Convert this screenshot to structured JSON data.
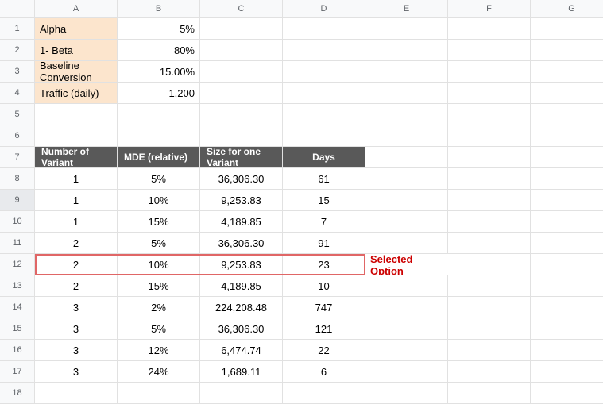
{
  "columns": [
    "A",
    "B",
    "C",
    "D",
    "E",
    "F",
    "G"
  ],
  "rows": [
    "1",
    "2",
    "3",
    "4",
    "5",
    "6",
    "7",
    "8",
    "9",
    "10",
    "11",
    "12",
    "13",
    "14",
    "15",
    "16",
    "17",
    "18"
  ],
  "params": {
    "alpha_label": "Alpha",
    "alpha_value": "5%",
    "beta_label": "1- Beta",
    "beta_value": "80%",
    "baseline_label": "Baseline Conversion",
    "baseline_value": "15.00%",
    "traffic_label": "Traffic (daily)",
    "traffic_value": "1,200"
  },
  "table_headers": {
    "variant": "Number of Variant",
    "mde": "MDE (relative)",
    "size": "Size for one Variant",
    "days": "Days"
  },
  "table_rows": [
    {
      "variant": "1",
      "mde": "5%",
      "size": "36,306.30",
      "days": "61"
    },
    {
      "variant": "1",
      "mde": "10%",
      "size": "9,253.83",
      "days": "15"
    },
    {
      "variant": "1",
      "mde": "15%",
      "size": "4,189.85",
      "days": "7"
    },
    {
      "variant": "2",
      "mde": "5%",
      "size": "36,306.30",
      "days": "91"
    },
    {
      "variant": "2",
      "mde": "10%",
      "size": "9,253.83",
      "days": "23"
    },
    {
      "variant": "2",
      "mde": "15%",
      "size": "4,189.85",
      "days": "10"
    },
    {
      "variant": "3",
      "mde": "2%",
      "size": "224,208.48",
      "days": "747"
    },
    {
      "variant": "3",
      "mde": "5%",
      "size": "36,306.30",
      "days": "121"
    },
    {
      "variant": "3",
      "mde": "12%",
      "size": "6,474.74",
      "days": "22"
    },
    {
      "variant": "3",
      "mde": "24%",
      "size": "1,689.11",
      "days": "6"
    }
  ],
  "annotation": "Selected Option",
  "selected_row_index": 4,
  "chart_data": {
    "type": "table",
    "parameters": {
      "Alpha": 0.05,
      "1- Beta": 0.8,
      "Baseline Conversion": 0.15,
      "Traffic (daily)": 1200
    },
    "columns": [
      "Number of Variant",
      "MDE (relative)",
      "Size for one Variant",
      "Days"
    ],
    "rows": [
      [
        1,
        0.05,
        36306.3,
        61
      ],
      [
        1,
        0.1,
        9253.83,
        15
      ],
      [
        1,
        0.15,
        4189.85,
        7
      ],
      [
        2,
        0.05,
        36306.3,
        91
      ],
      [
        2,
        0.1,
        9253.83,
        23
      ],
      [
        2,
        0.15,
        4189.85,
        10
      ],
      [
        3,
        0.02,
        224208.48,
        747
      ],
      [
        3,
        0.05,
        36306.3,
        121
      ],
      [
        3,
        0.12,
        6474.74,
        22
      ],
      [
        3,
        0.24,
        1689.11,
        6
      ]
    ],
    "highlighted_row": {
      "Number of Variant": 2,
      "MDE (relative)": 0.1,
      "Size for one Variant": 9253.83,
      "Days": 23
    }
  }
}
